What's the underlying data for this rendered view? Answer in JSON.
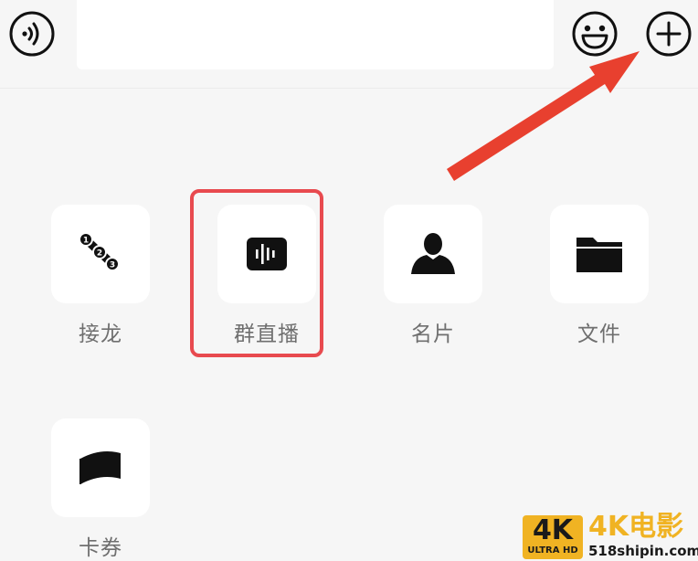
{
  "input_bar": {
    "voice_icon": "voice-icon",
    "text_value": "",
    "emoji_icon": "emoji-icon",
    "more_icon": "plus-icon"
  },
  "tools": [
    {
      "label": "接龙",
      "icon": "relay-icon"
    },
    {
      "label": "群直播",
      "icon": "live-stream-icon"
    },
    {
      "label": "名片",
      "icon": "contact-card-icon"
    },
    {
      "label": "文件",
      "icon": "folder-icon"
    },
    {
      "label": "卡券",
      "icon": "coupon-icon"
    }
  ],
  "annotations": {
    "highlight_color": "#e84a4f",
    "arrow_color": "#e8402f"
  },
  "watermark": {
    "badge_main": "4K",
    "badge_sub": "ULTRA HD",
    "title": "4K电影",
    "url": "518shipin.com",
    "color": "#f0b323"
  }
}
